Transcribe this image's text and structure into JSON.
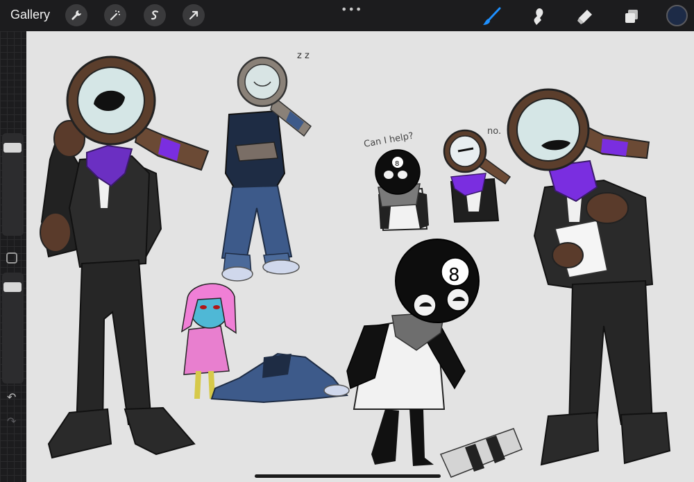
{
  "toolbar": {
    "gallery_label": "Gallery",
    "left_tools": [
      "wrench-icon",
      "magic-wand-icon",
      "selection-icon",
      "transform-arrow-icon"
    ],
    "more_label": "•••",
    "right_tools": [
      "brush-icon",
      "smudge-icon",
      "eraser-icon",
      "layers-icon"
    ],
    "active_tool": "brush-icon",
    "current_color": "#1d2b47",
    "accent_color": "#1e90ff"
  },
  "sidebar": {
    "brush_size_level": 0.07,
    "opacity_level": 0.07,
    "undo_icon": "undo-icon",
    "redo_icon": "redo-icon"
  },
  "canvas": {
    "background_color": "#e3e3e3",
    "annotations": {
      "zzz": "z z",
      "speech_can_i_help": "Can I help?",
      "speech_no": "no."
    },
    "ball_label": "8"
  }
}
